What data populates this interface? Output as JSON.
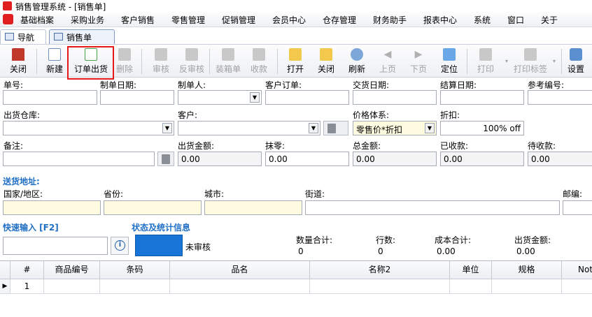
{
  "window": {
    "title": "销售管理系统 - [销售单]"
  },
  "menu": [
    "基础档案",
    "采购业务",
    "客户销售",
    "零售管理",
    "促销管理",
    "会员中心",
    "仓存管理",
    "财务助手",
    "报表中心",
    "系统",
    "窗口",
    "关于"
  ],
  "tabs": [
    {
      "label": "导航"
    },
    {
      "label": "销售单"
    }
  ],
  "toolbar": {
    "close": "关闭",
    "new": "新建",
    "order_ship": "订单出货",
    "delete": "删除",
    "approve": "审核",
    "unapprove": "反审核",
    "packing": "装箱单",
    "collect": "收款",
    "open": "打开",
    "close2": "关闭",
    "refresh": "刷新",
    "prev": "上页",
    "next": "下页",
    "locate": "定位",
    "print": "打印",
    "print_label": "打印标签",
    "settings": "设置"
  },
  "form": {
    "doc_no": "单号:",
    "doc_date": "制单日期:",
    "maker": "制单人:",
    "cust_order": "客户订单:",
    "delivery_date": "交货日期:",
    "settle_date": "结算日期:",
    "ref_no": "参考编号:",
    "warehouse": "出货仓库:",
    "customer": "客户:",
    "price_system": "价格体系:",
    "price_system_value": "零售价*折扣",
    "discount": "折扣:",
    "discount_value": "100% off",
    "remark": "备注:",
    "ship_amount": "出货金额:",
    "ship_amount_value": "0.00",
    "round": "抹零:",
    "round_value": "0.00",
    "total": "总金额:",
    "total_value": "0.00",
    "received": "已收款:",
    "received_value": "0.00",
    "pending": "待收款:",
    "pending_value": "0.00"
  },
  "address": {
    "section": "送货地址:",
    "country": "国家/地区:",
    "province": "省份:",
    "city": "城市:",
    "street": "街道:",
    "zip": "邮编:"
  },
  "quick": {
    "section": "快速输入 [F2]"
  },
  "status": {
    "section": "状态及统计信息",
    "state": "未审核",
    "qty_label": "数量合计:",
    "qty_value": "0",
    "rows_label": "行数:",
    "rows_value": "0",
    "cost_label": "成本合计:",
    "cost_value": "0.00",
    "ship_label": "出货金额:",
    "ship_value": "0.00"
  },
  "grid": {
    "headers": [
      "#",
      "商品编号",
      "条码",
      "品名",
      "名称2",
      "单位",
      "规格",
      "Not"
    ],
    "row1_no": "1"
  },
  "colors": {
    "highlight": "#e81818",
    "section": "#1f6fc5",
    "status_block": "#1874d6",
    "field_yellow": "#fffbe0"
  }
}
